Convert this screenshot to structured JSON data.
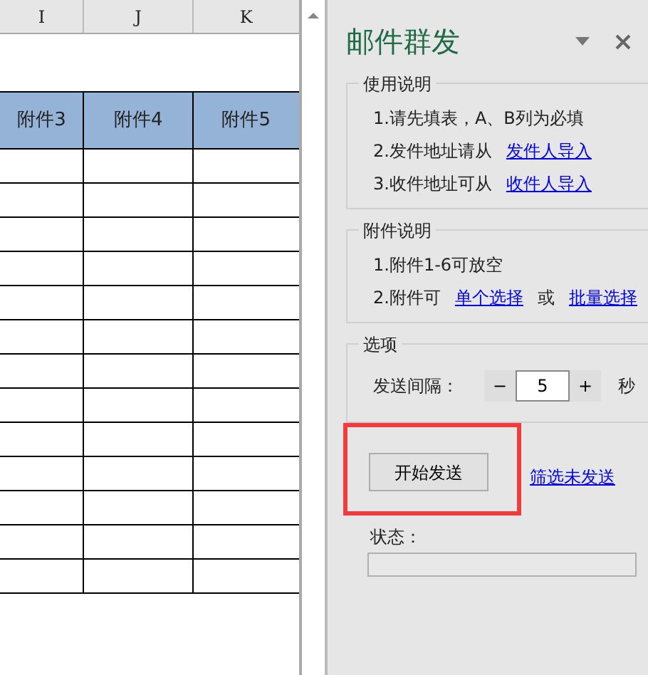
{
  "sheet": {
    "column_headers": [
      "I",
      "J",
      "K"
    ],
    "table_header": [
      "附件3",
      "附件4",
      "附件5"
    ]
  },
  "pane": {
    "title": "邮件群发",
    "groups": [
      {
        "title": "使用说明",
        "lines": [
          [
            {
              "kind": "text",
              "text": "1.请先填表，A、B列为必填"
            }
          ],
          [
            {
              "kind": "text",
              "text": "2.发件地址请从"
            },
            {
              "kind": "link",
              "text": "发件人导入"
            }
          ],
          [
            {
              "kind": "text",
              "text": "3.收件地址可从"
            },
            {
              "kind": "link",
              "text": "收件人导入"
            }
          ]
        ]
      },
      {
        "title": "附件说明",
        "lines": [
          [
            {
              "kind": "text",
              "text": "1.附件1-6可放空"
            }
          ],
          [
            {
              "kind": "text",
              "text": "2.附件可"
            },
            {
              "kind": "link",
              "text": "单个选择"
            },
            {
              "kind": "text",
              "text": "或"
            },
            {
              "kind": "link",
              "text": "批量选择"
            }
          ]
        ]
      }
    ],
    "options": {
      "title": "选项",
      "label": "发送间隔：",
      "minus": "−",
      "value": "5",
      "plus": "+",
      "unit": "秒"
    },
    "start_button": {
      "label": "开始发送",
      "highlighted": true
    },
    "filter_link": "筛选未发送",
    "status_label": "状态："
  }
}
